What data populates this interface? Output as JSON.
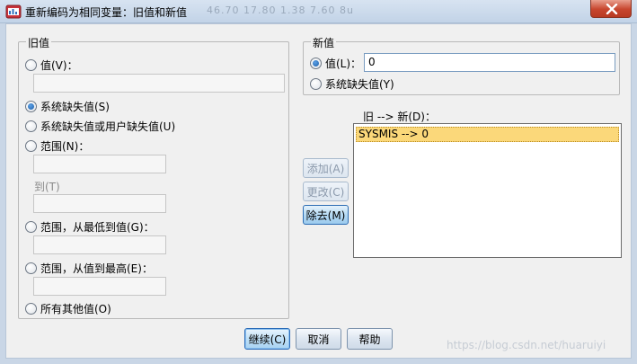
{
  "window": {
    "title": "重新编码为相同变量：旧值和新值",
    "background_strip": "46.70    17.80    1.38    7.60    8u"
  },
  "old_value": {
    "legend": "旧值",
    "value_label": "值(V)：",
    "value_input": "",
    "system_missing": "系统缺失值(S)",
    "system_or_user_missing": "系统缺失值或用户缺失值(U)",
    "range_label": "范围(N)：",
    "range_from": "",
    "range_to_label": "到(T)",
    "range_to": "",
    "range_lowest_label": "范围，从最低到值(G)：",
    "range_lowest_input": "",
    "range_highest_label": "范围，从值到最高(E)：",
    "range_highest_input": "",
    "all_other": "所有其他值(O)",
    "selected": "system_missing"
  },
  "new_value": {
    "legend": "新值",
    "value_label": "值(L)：",
    "value_input": "0",
    "system_missing": "系统缺失值(Y)",
    "selected": "value"
  },
  "mapping": {
    "label": "旧 --> 新(D)：",
    "items": [
      "SYSMIS --> 0"
    ]
  },
  "actions": {
    "add": "添加(A)",
    "change": "更改(C)",
    "remove": "除去(M)"
  },
  "footer": {
    "continue": "继续(C)",
    "cancel": "取消",
    "help": "帮助"
  },
  "watermark": "https://blog.csdn.net/huaruiyi",
  "colors": {
    "selection": "#fbd87a",
    "titlebar": "#c2d3e7",
    "close": "#c7452d"
  }
}
